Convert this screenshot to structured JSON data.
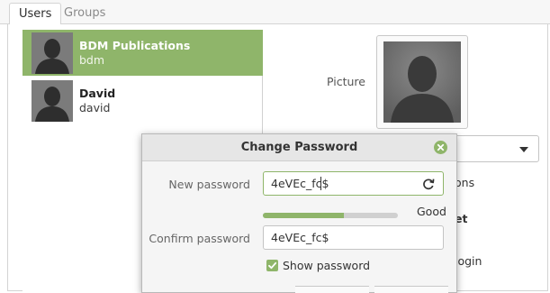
{
  "tabs": [
    {
      "label": "Users",
      "active": true
    },
    {
      "label": "Groups",
      "active": false
    }
  ],
  "users": [
    {
      "name": "BDM Publications",
      "login": "bdm",
      "selected": true
    },
    {
      "name": "David",
      "login": "david",
      "selected": false
    }
  ],
  "details": {
    "picture_label": "Picture",
    "partial_labels": [
      "ons",
      "et",
      "login"
    ]
  },
  "dialog": {
    "title": "Change Password",
    "new_password_label": "New password",
    "new_password_value": "4eVEc_fc$",
    "strength": 0.6,
    "strength_text": "Good",
    "confirm_password_label": "Confirm password",
    "confirm_password_value": "4eVEc_fc$",
    "show_password_label": "Show password",
    "show_password_checked": true
  },
  "colors": {
    "accent": "#8fb56a"
  },
  "icons": {
    "close": "close-icon",
    "regenerate": "refresh-icon",
    "dropdown": "chevron-down-icon",
    "checkbox": "checkmark-icon"
  }
}
